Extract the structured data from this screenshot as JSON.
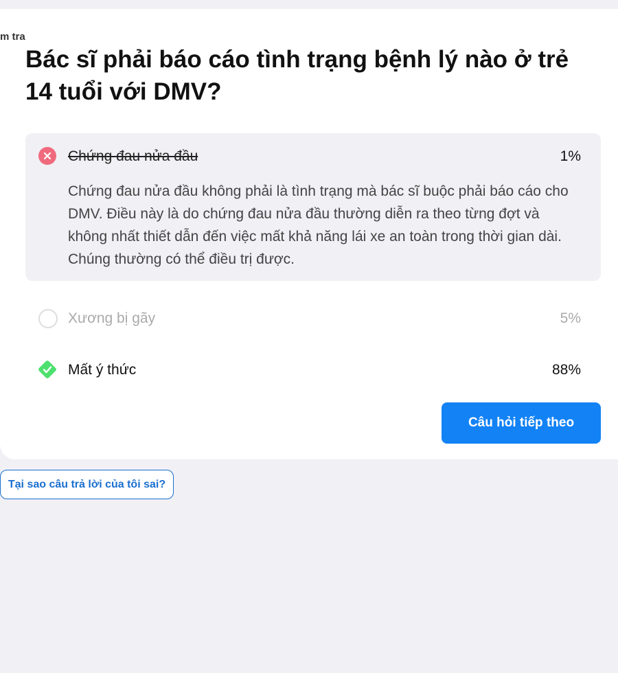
{
  "header": {
    "clipped_label": "m tra"
  },
  "question": {
    "text": "Bác sĩ phải báo cáo tình trạng bệnh lý nào ở trẻ 14 tuổi với DMV?"
  },
  "options": [
    {
      "label": "Chứng đau nửa đầu",
      "percent": "1%",
      "state": "wrong",
      "explanation": "Chứng đau nửa đầu không phải là tình trạng mà bác sĩ buộc phải báo cáo cho DMV. Điều này là do chứng đau nửa đầu thường diễn ra theo từng đợt và không nhất thiết dẫn đến việc mất khả năng lái xe an toàn trong thời gian dài. Chúng thường có thể điều trị được."
    },
    {
      "label": "Xương bị gãy",
      "percent": "5%",
      "state": "neutral"
    },
    {
      "label": "Mất ý thức",
      "percent": "88%",
      "state": "correct"
    }
  ],
  "buttons": {
    "next": "Câu hỏi tiếp theo",
    "why_wrong": "Tại sao câu trả lời của tôi sai?"
  },
  "colors": {
    "accent": "#1282f5",
    "wrong": "#f06a7d",
    "correct": "#4ee06f",
    "background": "#f0f0f5"
  },
  "icons": {
    "wrong": "x-circle-icon",
    "neutral": "empty-circle-icon",
    "correct": "check-diamond-icon"
  }
}
